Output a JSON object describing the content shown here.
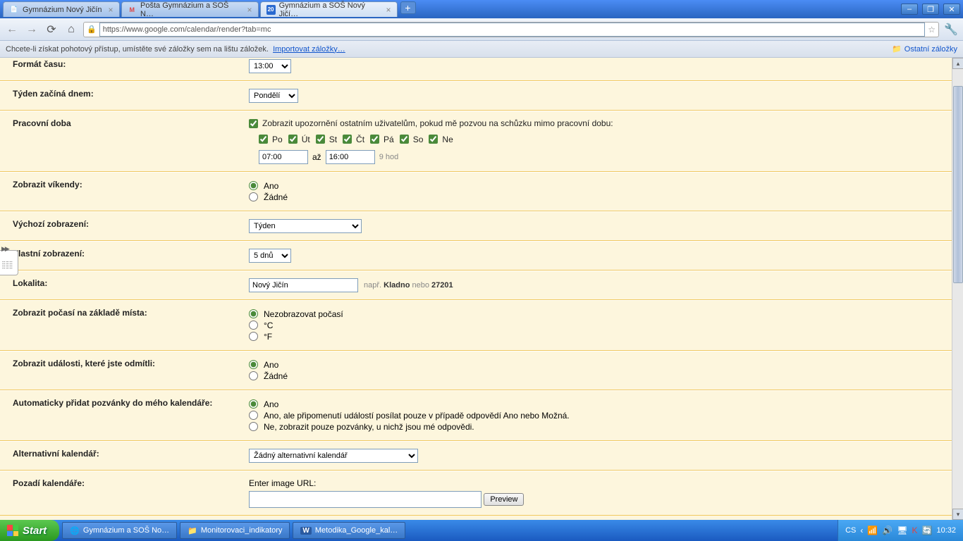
{
  "browser": {
    "tabs": [
      {
        "title": "Gymnázium Nový Jičín",
        "favicon": "📄"
      },
      {
        "title": "Pošta Gymnázium a SOŠ N…",
        "favicon": "M"
      },
      {
        "title": "Gymnázium a SOŠ Nový Jičí…",
        "favicon": "20"
      }
    ],
    "url": "https://www.google.com/calendar/render?tab=mc",
    "bookmark_hint": "Chcete-li získat pohotový přístup, umístěte své záložky sem na lištu záložek.",
    "import_link": "Importovat záložky…",
    "other_bookmarks": "Ostatní záložky"
  },
  "settings": {
    "time_format": {
      "label": "Formát času:",
      "value": "13:00"
    },
    "week_start": {
      "label": "Týden začíná dnem:",
      "value": "Pondělí"
    },
    "work_hours": {
      "label": "Pracovní doba",
      "checkbox": "Zobrazit upozornění ostatním uživatelům, pokud mě pozvou na schůzku mimo pracovní dobu:",
      "days": [
        "Po",
        "Út",
        "St",
        "Čt",
        "Pá",
        "So",
        "Ne"
      ],
      "from": "07:00",
      "between": "až",
      "to": "16:00",
      "duration": "9 hod"
    },
    "show_weekends": {
      "label": "Zobrazit víkendy:",
      "yes": "Ano",
      "none": "Žádné"
    },
    "default_view": {
      "label": "Výchozí zobrazení:",
      "value": "Týden"
    },
    "custom_view": {
      "label": "Vlastní zobrazení:",
      "value": "5 dnů"
    },
    "locality": {
      "label": "Lokalita:",
      "value": "Nový Jičín",
      "eg_prefix": "např.",
      "eg_bold1": "Kladno",
      "eg_mid": " nebo ",
      "eg_bold2": "27201"
    },
    "weather": {
      "label": "Zobrazit počasí na základě místa:",
      "none": "Nezobrazovat počasí",
      "c": "°C",
      "f": "°F"
    },
    "declined": {
      "label": "Zobrazit události, které jste odmítli:",
      "yes": "Ano",
      "none": "Žádné"
    },
    "auto_add": {
      "label": "Automaticky přidat pozvánky do mého kalendáře:",
      "opt1": "Ano",
      "opt2": "Ano, ale připomenutí událostí posílat pouze v případě odpovědí Ano nebo Možná.",
      "opt3": "Ne, zobrazit pouze pozvánky, u nichž jsou mé odpovědi."
    },
    "alt_cal": {
      "label": "Alternativní kalendář:",
      "value": "Žádný alternativní kalendář"
    },
    "background": {
      "label": "Pozadí kalendáře:",
      "prompt": "Enter image URL:",
      "preview": "Preview"
    }
  },
  "taskbar": {
    "start": "Start",
    "buttons": [
      {
        "icon": "🌐",
        "label": "Gymnázium a SOŠ No…"
      },
      {
        "icon": "📁",
        "label": "Monitorovaci_indikatory"
      },
      {
        "icon": "W",
        "label": "Metodika_Google_kal…"
      }
    ],
    "lang": "CS",
    "clock": "10:32"
  }
}
